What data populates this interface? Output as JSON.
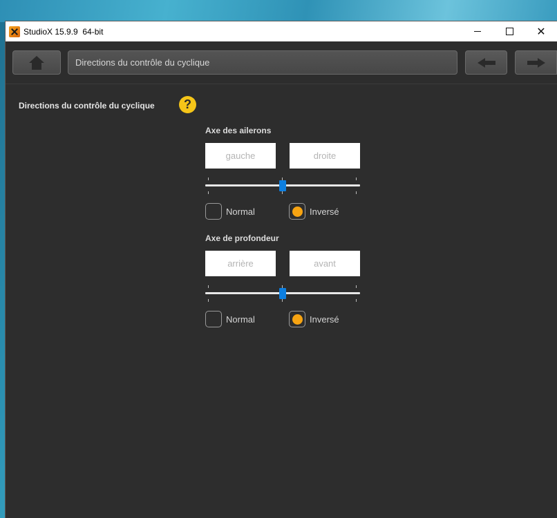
{
  "window": {
    "title": "StudioX 15.9.9  64-bit",
    "controls": {
      "minimize_icon": "minimize-icon",
      "maximize_icon": "maximize-icon",
      "close_icon": "close-icon",
      "close_glyph": "✕"
    }
  },
  "toolbar": {
    "breadcrumb": "Directions du contrôle du cyclique",
    "icons": {
      "home": "home-icon",
      "back": "arrow-left-icon",
      "forward": "arrow-right-icon"
    }
  },
  "page": {
    "title": "Directions du contrôle du cyclique",
    "help_glyph": "?",
    "help_icon": "question-icon"
  },
  "sections": [
    {
      "label": "Axe des ailerons",
      "fields": [
        {
          "value": "",
          "placeholder": "gauche"
        },
        {
          "value": "",
          "placeholder": "droite"
        }
      ],
      "slider_value": 0.5,
      "options": [
        {
          "label": "Normal",
          "selected": false
        },
        {
          "label": "Inversé",
          "selected": true
        }
      ]
    },
    {
      "label": "Axe de profondeur",
      "fields": [
        {
          "value": "",
          "placeholder": "arrière"
        },
        {
          "value": "",
          "placeholder": "avant"
        }
      ],
      "slider_value": 0.5,
      "options": [
        {
          "label": "Normal",
          "selected": false
        },
        {
          "label": "Inversé",
          "selected": true
        }
      ]
    }
  ],
  "colors": {
    "accent": "#f7a412",
    "slider_thumb": "#0d7fe0",
    "help_badge": "#f5c518",
    "panel_bg": "#2d2d2d"
  }
}
